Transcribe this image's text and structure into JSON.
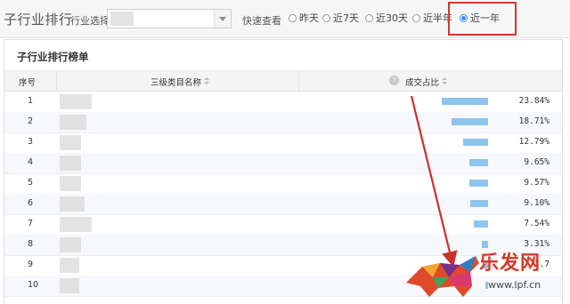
{
  "header": {
    "title": "子行业排行",
    "industry_label": "行业选择",
    "quick_view_label": "快速查看",
    "radios": [
      {
        "label": "昨天",
        "selected": false
      },
      {
        "label": "近7天",
        "selected": false
      },
      {
        "label": "近30天",
        "selected": false
      },
      {
        "label": "近半年",
        "selected": false
      },
      {
        "label": "近一年",
        "selected": true
      }
    ]
  },
  "panel": {
    "title": "子行业排行榜单",
    "columns": {
      "rank": "序号",
      "name": "三级类目名称",
      "share": "成交占比"
    },
    "rows": [
      {
        "rank": "1",
        "share": 23.84,
        "share_label": "23.84%"
      },
      {
        "rank": "2",
        "share": 18.71,
        "share_label": "18.71%"
      },
      {
        "rank": "3",
        "share": 12.79,
        "share_label": "12.79%"
      },
      {
        "rank": "4",
        "share": 9.65,
        "share_label": "9.65%"
      },
      {
        "rank": "5",
        "share": 9.57,
        "share_label": "9.57%"
      },
      {
        "rank": "6",
        "share": 9.1,
        "share_label": "9.10%"
      },
      {
        "rank": "7",
        "share": 7.54,
        "share_label": "7.54%"
      },
      {
        "rank": "8",
        "share": 3.31,
        "share_label": "3.31%"
      },
      {
        "rank": "9",
        "share": 2.7,
        "share_label": "2.7"
      },
      {
        "rank": "10",
        "share": 0.5,
        "share_label": ""
      }
    ]
  },
  "watermark": {
    "brand": "乐发网",
    "url": "www.lpf.cn"
  },
  "colors": {
    "bar": "#8ec5ec",
    "highlight": "#d0382f",
    "radio_selected": "#3a8ee6"
  }
}
